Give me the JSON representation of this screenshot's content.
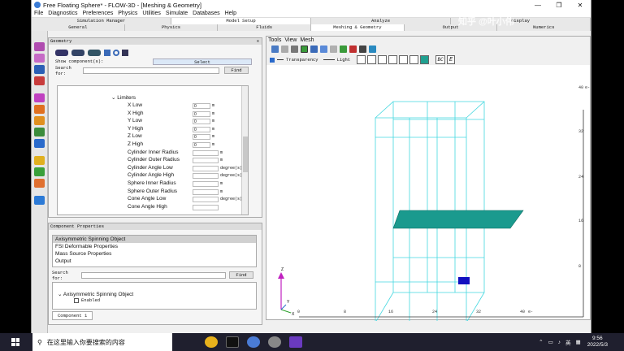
{
  "window": {
    "title": "Free Floating Sphere* - FLOW-3D - [Meshing & Geometry]",
    "controls": [
      "—",
      "❐",
      "✕"
    ]
  },
  "menu": [
    "File",
    "Diagnostics",
    "Preferences",
    "Physics",
    "Utilities",
    "Simulate",
    "Databases",
    "Help"
  ],
  "tabs_top": [
    "Simulation Manager",
    "Model Setup",
    "Analyze",
    "Display"
  ],
  "tabs_top_active": 1,
  "tabs_sub": [
    "General",
    "Physics",
    "Fluids",
    "Meshing & Geometry",
    "Output",
    "Numerics"
  ],
  "tabs_sub_active": 3,
  "geometry": {
    "title": "Geometry",
    "close": "✕",
    "show_label": "Show component(s):",
    "show_value": "Select",
    "search_label": "Search for:",
    "find_label": "Find",
    "limiters_label": "Limiters",
    "props": [
      {
        "name": "X Low",
        "value": "0",
        "unit": "m",
        "half": true
      },
      {
        "name": "X High",
        "value": "0",
        "unit": "m",
        "half": true
      },
      {
        "name": "Y Low",
        "value": "0",
        "unit": "m",
        "half": true
      },
      {
        "name": "Y High",
        "value": "0",
        "unit": "m",
        "half": true
      },
      {
        "name": "Z Low",
        "value": "0",
        "unit": "m",
        "half": true
      },
      {
        "name": "Z High",
        "value": "0",
        "unit": "m",
        "half": true
      },
      {
        "name": "Cylinder Inner Radius",
        "value": "",
        "unit": "m",
        "half": false
      },
      {
        "name": "Cylinder Outer Radius",
        "value": "",
        "unit": "m",
        "half": false
      },
      {
        "name": "Cylinder Angle Low",
        "value": "",
        "unit": "degree(s)",
        "half": false
      },
      {
        "name": "Cylinder Angle High",
        "value": "",
        "unit": "degree(s)",
        "half": false
      },
      {
        "name": "Sphere Inner Radius",
        "value": "",
        "unit": "m",
        "half": false
      },
      {
        "name": "Sphere Outer Radius",
        "value": "",
        "unit": "m",
        "half": false
      },
      {
        "name": "Cone Angle Low",
        "value": "",
        "unit": "degree(s)",
        "half": false
      },
      {
        "name": "Cone Angle High",
        "value": "",
        "unit": "",
        "half": false
      }
    ]
  },
  "component_properties": {
    "title": "Component Properties",
    "items": [
      "Axisymmetric Spinning Object",
      "FSI Deformable Properties",
      "Mass Source Properties",
      "Output"
    ],
    "selected": 0,
    "search_label": "Search for:",
    "find_label": "Find",
    "section": "Axisymmetric Spinning Object",
    "enabled_label": "Enabled",
    "footer_tab": "Component 1"
  },
  "view": {
    "menu": [
      "Tools",
      "View",
      "Mesh"
    ],
    "transparency_label": "Transparency",
    "light_label": "Light",
    "bc_label": "BC",
    "e_label": "E",
    "x_ticks": [
      "0",
      "8",
      "16",
      "24",
      "32",
      "40"
    ],
    "x_unit": "e-",
    "y_ticks": [
      "8",
      "16",
      "24",
      "32",
      "40"
    ],
    "y_unit": "e-",
    "axis_z": "Z",
    "axis_y": "Y",
    "axis_x": "X"
  },
  "taskbar": {
    "search_placeholder": "在这里输入你要搜索的内容",
    "lang": "英",
    "time": "9:56",
    "date": "2022/5/3"
  },
  "watermark": "知乎 @叶小伟"
}
